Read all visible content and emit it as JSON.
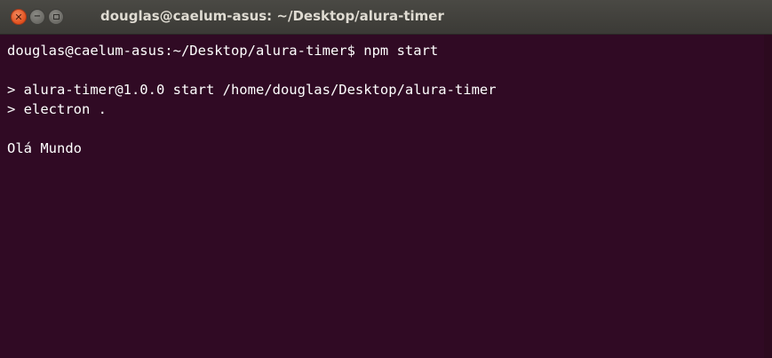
{
  "window": {
    "title": "douglas@caelum-asus: ~/Desktop/alura-timer",
    "controls": {
      "close_glyph": "✕",
      "minimize_glyph": "−"
    },
    "colors": {
      "terminal_background": "#300a24",
      "titlebar": "#3c3b37",
      "close_button": "#e95420",
      "text": "#ffffff"
    }
  },
  "terminal": {
    "lines": [
      "douglas@caelum-asus:~/Desktop/alura-timer$ npm start",
      "",
      "> alura-timer@1.0.0 start /home/douglas/Desktop/alura-timer",
      "> electron .",
      "",
      "Olá Mundo"
    ]
  }
}
